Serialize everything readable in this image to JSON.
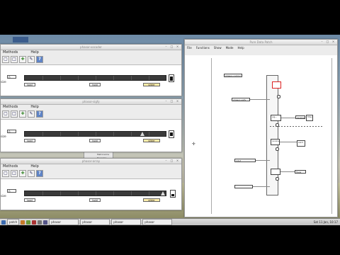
{
  "window_left_1": {
    "title": "phasor-vocoder",
    "menus": [
      "Methods",
      "Help"
    ],
    "number_value": "0",
    "side_label": "size",
    "buttons": {
      "left": "load",
      "middle": "hold",
      "right": "slider"
    }
  },
  "window_left_2": {
    "title": "phasor-sigfy",
    "menus": [
      "Methods",
      "Help"
    ],
    "number_value": "0",
    "side_label": "size",
    "buttons": {
      "left": "load",
      "middle": "hold",
      "right": "slider"
    }
  },
  "window_left_3": {
    "title": "phasor-array",
    "menus": [
      "Methods",
      "Help"
    ],
    "number_value": "0",
    "side_label": "size",
    "buttons": {
      "left": "load",
      "middle": "hold",
      "right": "slider"
    }
  },
  "window_right": {
    "title": "Pure Data Patch",
    "menus": [
      "File",
      "Functions",
      "Show",
      "Mode",
      "Help"
    ],
    "objects": [
      "phasor-control",
      "phasor-sigfy",
      "sig~",
      "receive",
      "filter",
      "receive",
      "send",
      "mtof",
      "flags"
    ]
  },
  "background_panel": {
    "items": [
      "m~",
      "Metronome",
      "Recorder"
    ]
  },
  "taskbar": {
    "items": [
      "patch",
      "",
      "",
      "",
      "",
      "",
      "phasor",
      "phasor",
      "phasor",
      "phasor"
    ],
    "right_text": "Sat 11 Jan, 10:17"
  },
  "colors": {
    "accent": "#5e83c5",
    "slider_highlight": "#ffeeaa",
    "selection": "#d22222"
  }
}
